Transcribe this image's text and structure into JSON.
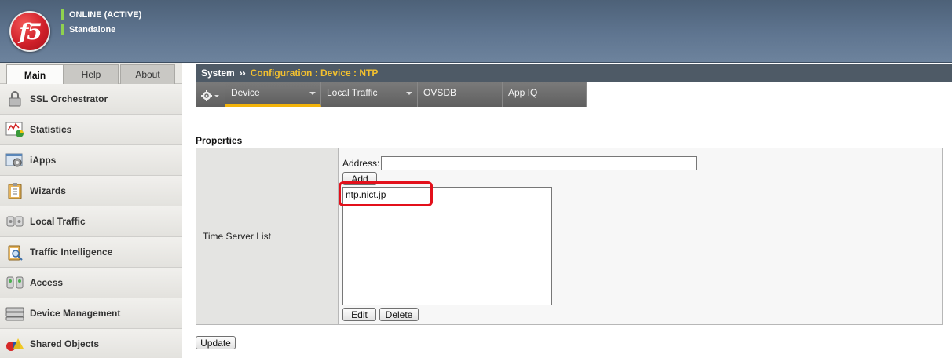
{
  "banner": {
    "logo_text": "f5",
    "status_line1": "ONLINE (ACTIVE)",
    "status_line2": "Standalone",
    "status_color": "#8fd14f"
  },
  "nav_tabs": [
    {
      "label": "Main",
      "active": true
    },
    {
      "label": "Help",
      "active": false
    },
    {
      "label": "About",
      "active": false
    }
  ],
  "sidebar": {
    "items": [
      {
        "label": "SSL Orchestrator",
        "icon": "lock-icon"
      },
      {
        "label": "Statistics",
        "icon": "statistics-chart-icon"
      },
      {
        "label": "iApps",
        "icon": "iapps-gear-icon"
      },
      {
        "label": "Wizards",
        "icon": "clipboard-icon"
      },
      {
        "label": "Local Traffic",
        "icon": "local-traffic-icon"
      },
      {
        "label": "Traffic Intelligence",
        "icon": "magnifier-clipboard-icon"
      },
      {
        "label": "Access",
        "icon": "access-icon"
      },
      {
        "label": "Device Management",
        "icon": "server-icon"
      },
      {
        "label": "Shared Objects",
        "icon": "shapes-icon"
      }
    ]
  },
  "breadcrumb": {
    "root": "System",
    "separator": "››",
    "path": "Configuration : Device : NTP",
    "path_color": "#f2c02f"
  },
  "menu": {
    "items": [
      {
        "label": "Device",
        "dropdown": true,
        "active": true
      },
      {
        "label": "Local Traffic",
        "dropdown": true,
        "active": false
      },
      {
        "label": "OVSDB",
        "dropdown": false,
        "active": false
      },
      {
        "label": "App IQ",
        "dropdown": false,
        "active": false
      }
    ]
  },
  "properties": {
    "title": "Properties",
    "row_label": "Time Server List",
    "address_label": "Address:",
    "address_value": "",
    "add_button": "Add",
    "servers": [
      "ntp.nict.jp"
    ],
    "edit_button": "Edit",
    "delete_button": "Delete",
    "highlight_color": "#e3101b"
  },
  "footer": {
    "update_button": "Update"
  }
}
